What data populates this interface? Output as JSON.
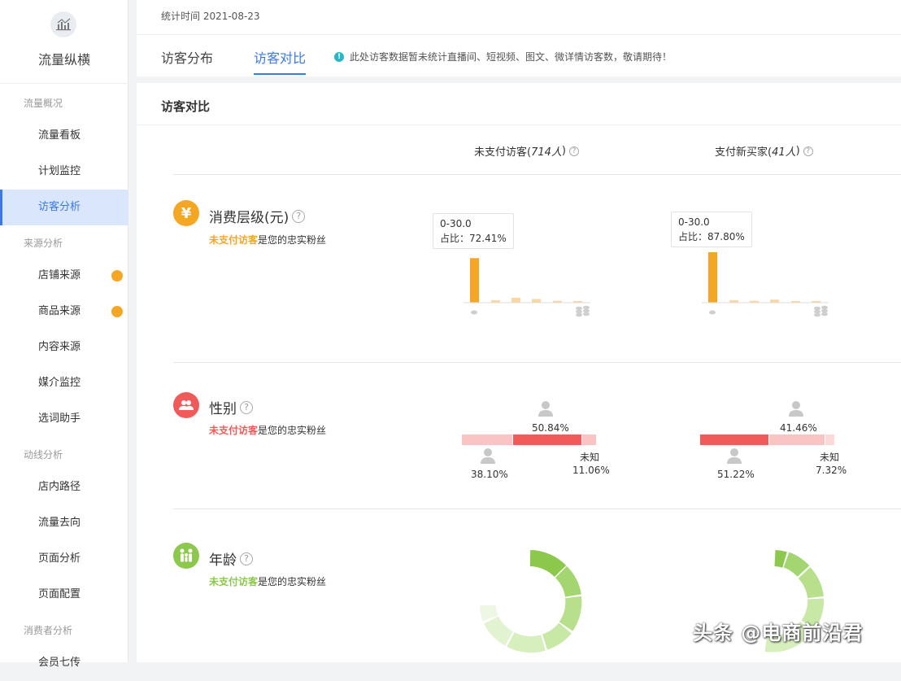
{
  "app": {
    "title": "流量纵横"
  },
  "sidebar": {
    "sections": [
      {
        "label": "流量概况",
        "items": [
          "流量看板",
          "计划监控",
          "访客分析"
        ]
      },
      {
        "label": "来源分析",
        "items": [
          "店铺来源",
          "商品来源",
          "内容来源",
          "媒介监控",
          "选词助手"
        ]
      },
      {
        "label": "动线分析",
        "items": [
          "店内路径",
          "流量去向",
          "页面分析",
          "页面配置"
        ]
      },
      {
        "label": "消费者分析",
        "items": [
          "会员七传"
        ]
      }
    ],
    "active_item": "访客分析"
  },
  "header": {
    "stat_date": "统计时间 2021-08-23",
    "tabs": [
      "访客分布",
      "访客对比"
    ],
    "active_tab": "访客对比",
    "notice": "此处访客数据暂未统计直播间、短视频、图文、微详情访客数，敬请期待！"
  },
  "main": {
    "title": "访客对比",
    "columns": [
      {
        "label": "未支付访客(",
        "count": "714人",
        "close": ")"
      },
      {
        "label": "支付新买家(",
        "count": "41人",
        "close": ")"
      }
    ],
    "rows": [
      {
        "title": "消费层级(元)",
        "sub_highlight": "未支付访客",
        "sub_rest": "是您的忠实粉丝",
        "color": "#f5a623"
      },
      {
        "title": "性别",
        "sub_highlight": "未支付访客",
        "sub_rest": "是您的忠实粉丝",
        "color": "#f25a5a"
      },
      {
        "title": "年龄",
        "sub_highlight": "未支付访客",
        "sub_rest": "是您的忠实粉丝",
        "color": "#8cc84b"
      }
    ],
    "consumption": [
      {
        "tooltip_range": "0-30.0",
        "tooltip_share": "占比：72.41%",
        "bars": [
          72.41,
          4,
          8,
          6,
          3,
          1
        ]
      },
      {
        "tooltip_range": "0-30.0",
        "tooltip_share": "占比：87.80%",
        "bars": [
          87.8,
          4,
          3,
          5,
          2,
          1
        ]
      }
    ],
    "gender": [
      {
        "female": "50.84%",
        "male": "38.10%",
        "unknown_label": "未知",
        "unknown": "11.06%",
        "female_pct": 50.84,
        "male_pct": 38.1,
        "unknown_pct": 11.06
      },
      {
        "female": "41.46%",
        "male": "51.22%",
        "unknown_label": "未知",
        "unknown": "7.32%",
        "female_pct": 41.46,
        "male_pct": 51.22,
        "unknown_pct": 7.32
      }
    ]
  },
  "watermark": "头条 @电商前沿君",
  "colors": {
    "accent": "#3a78e8",
    "orange": "#f5a623",
    "red": "#f25a5a",
    "green": "#8cc84b"
  }
}
